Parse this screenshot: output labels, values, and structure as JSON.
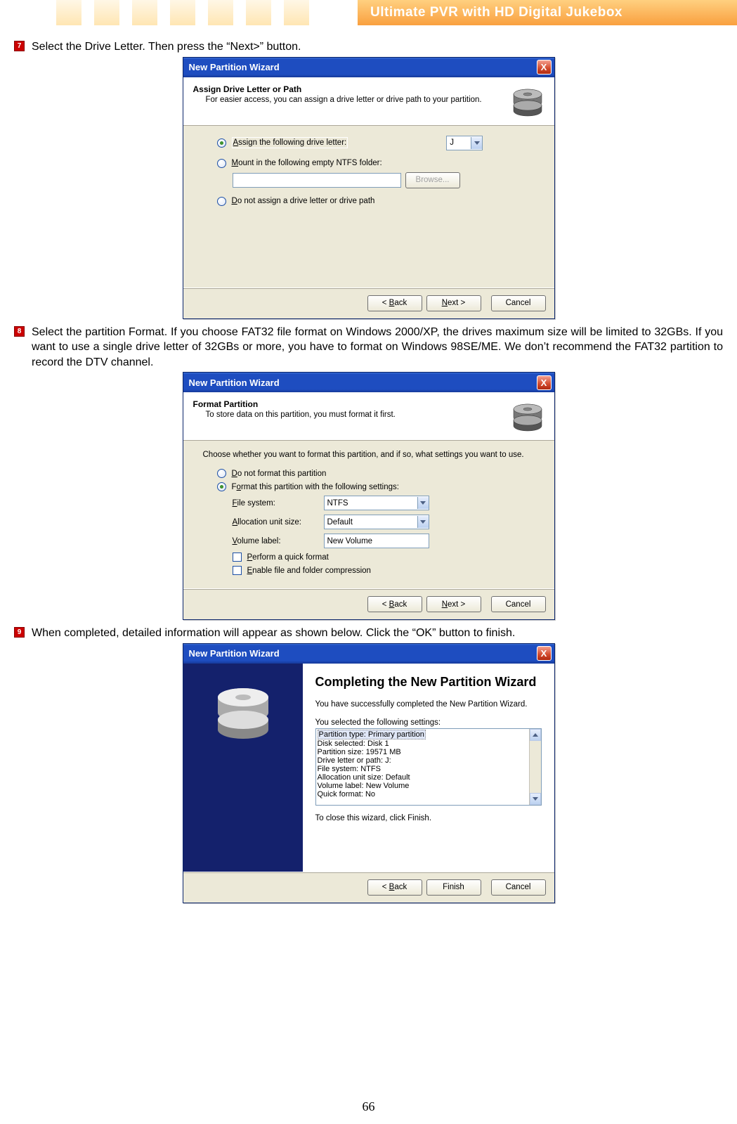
{
  "header": {
    "title": "Ultimate PVR with HD Digital Jukebox"
  },
  "page_number": "66",
  "steps": {
    "s7": {
      "num": "7",
      "text": "Select the Drive Letter. Then press the “Next>” button."
    },
    "s8": {
      "num": "8",
      "text": "Select the partition Format. If you choose FAT32 file format on Windows 2000/XP, the drives maximum size will be limited to 32GBs. If you want to use a single drive letter of 32GBs or more, you have to format on Windows 98SE/ME. We don’t recommend the FAT32 partition to record the DTV channel."
    },
    "s9": {
      "num": "9",
      "text": "When completed, detailed information will appear as shown below. Click the “OK” button to finish."
    }
  },
  "wiz": {
    "title": "New Partition Wizard",
    "close": "X",
    "back": "< Back",
    "next": "Next >",
    "cancel": "Cancel",
    "finish": "Finish"
  },
  "dlg1": {
    "heading": "Assign Drive Letter or Path",
    "sub": "For easier access, you can assign a drive letter or drive path to your partition.",
    "opt_assign": "Assign the following drive letter:",
    "drive": "J",
    "opt_mount": "Mount in the following empty NTFS folder:",
    "browse": "Browse...",
    "opt_none": "Do not assign a drive letter or drive path"
  },
  "dlg2": {
    "heading": "Format Partition",
    "sub": "To store data on this partition, you must format it first.",
    "intro": "Choose whether you want to format this partition, and if so, what settings you want to use.",
    "opt_noformat": "Do not format this partition",
    "opt_format": "Format this partition with the following settings:",
    "fs_label": "File system:",
    "fs_value": "NTFS",
    "au_label": "Allocation unit size:",
    "au_value": "Default",
    "vol_label": "Volume label:",
    "vol_value": "New Volume",
    "quick": "Perform a quick format",
    "compress": "Enable file and folder compression"
  },
  "dlg3": {
    "heading": "Completing the New Partition Wizard",
    "line1": "You have successfully completed the New Partition Wizard.",
    "line2": "You selected the following settings:",
    "settings": [
      "Partition type: Primary partition",
      "Disk selected: Disk 1",
      "Partition size: 19571 MB",
      "Drive letter or path: J:",
      "File system: NTFS",
      "Allocation unit size: Default",
      "Volume label: New Volume",
      "Quick format: No"
    ],
    "line3": "To close this wizard, click Finish."
  }
}
